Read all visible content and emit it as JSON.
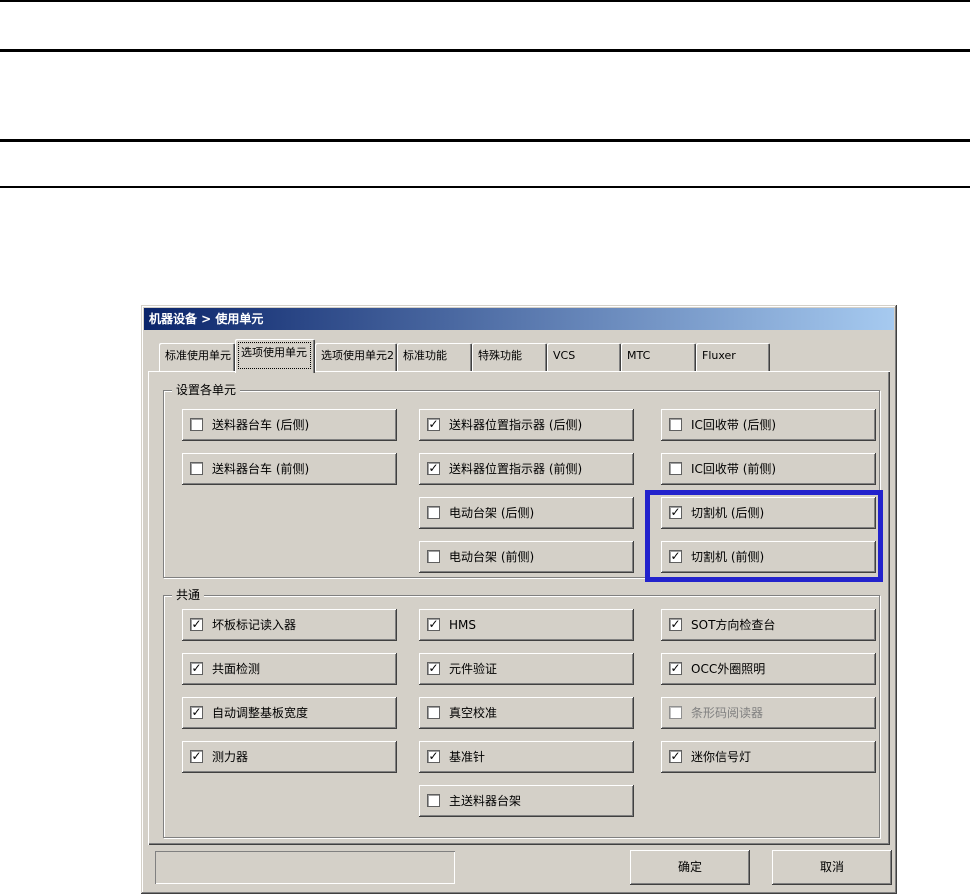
{
  "colors": {
    "dialog_bg": "#d4d0c8",
    "title_gradient_left": "#0a246a",
    "title_gradient_right": "#a6caf0",
    "highlight_box": "#2222cc",
    "disabled_text": "#808080"
  },
  "dialog": {
    "title": "机器设备 > 使用单元",
    "tabs": [
      {
        "label": "标准使用单元",
        "active": false
      },
      {
        "label": "选项使用单元",
        "active": true
      },
      {
        "label": "选项使用单元2",
        "active": false
      },
      {
        "label": "标准功能",
        "active": false
      },
      {
        "label": "特殊功能",
        "active": false
      },
      {
        "label": "VCS",
        "active": false
      },
      {
        "label": "MTC",
        "active": false
      },
      {
        "label": "Fluxer",
        "active": false
      }
    ],
    "group_units": {
      "label": "设置各单元",
      "items": [
        {
          "label": "送料器台车 (后侧)",
          "check": ""
        },
        {
          "label": "送料器位置指示器 (后侧)",
          "check": "✓"
        },
        {
          "label": "IC回收带 (后侧)",
          "check": ""
        },
        {
          "label": "送料器台车 (前侧)",
          "check": ""
        },
        {
          "label": "送料器位置指示器 (前侧)",
          "check": "✓"
        },
        {
          "label": "IC回收带 (前侧)",
          "check": ""
        },
        {
          "label": "电动台架 (后侧)",
          "check": ""
        },
        {
          "label": "切割机 (后侧)",
          "check": "✓"
        },
        {
          "label": "电动台架 (前侧)",
          "check": ""
        },
        {
          "label": "切割机 (前侧)",
          "check": "✓"
        }
      ]
    },
    "group_common": {
      "label": "共通",
      "items": [
        {
          "label": "坏板标记读入器",
          "check": "✓"
        },
        {
          "label": "HMS",
          "check": "✓"
        },
        {
          "label": "SOT方向检查台",
          "check": "✓"
        },
        {
          "label": "共面检测",
          "check": "✓"
        },
        {
          "label": "元件验证",
          "check": "✓"
        },
        {
          "label": "OCC外圈照明",
          "check": "✓"
        },
        {
          "label": "自动调整基板宽度",
          "check": "✓"
        },
        {
          "label": "真空校准",
          "check": ""
        },
        {
          "label": "条形码阅读器",
          "check": "",
          "disabled": true
        },
        {
          "label": "测力器",
          "check": "✓"
        },
        {
          "label": "基准针",
          "check": "✓"
        },
        {
          "label": "迷你信号灯",
          "check": "✓"
        },
        {
          "label": "主送料器台架",
          "check": ""
        }
      ]
    },
    "status_value": "",
    "ok_label": "确定",
    "cancel_label": "取消"
  }
}
